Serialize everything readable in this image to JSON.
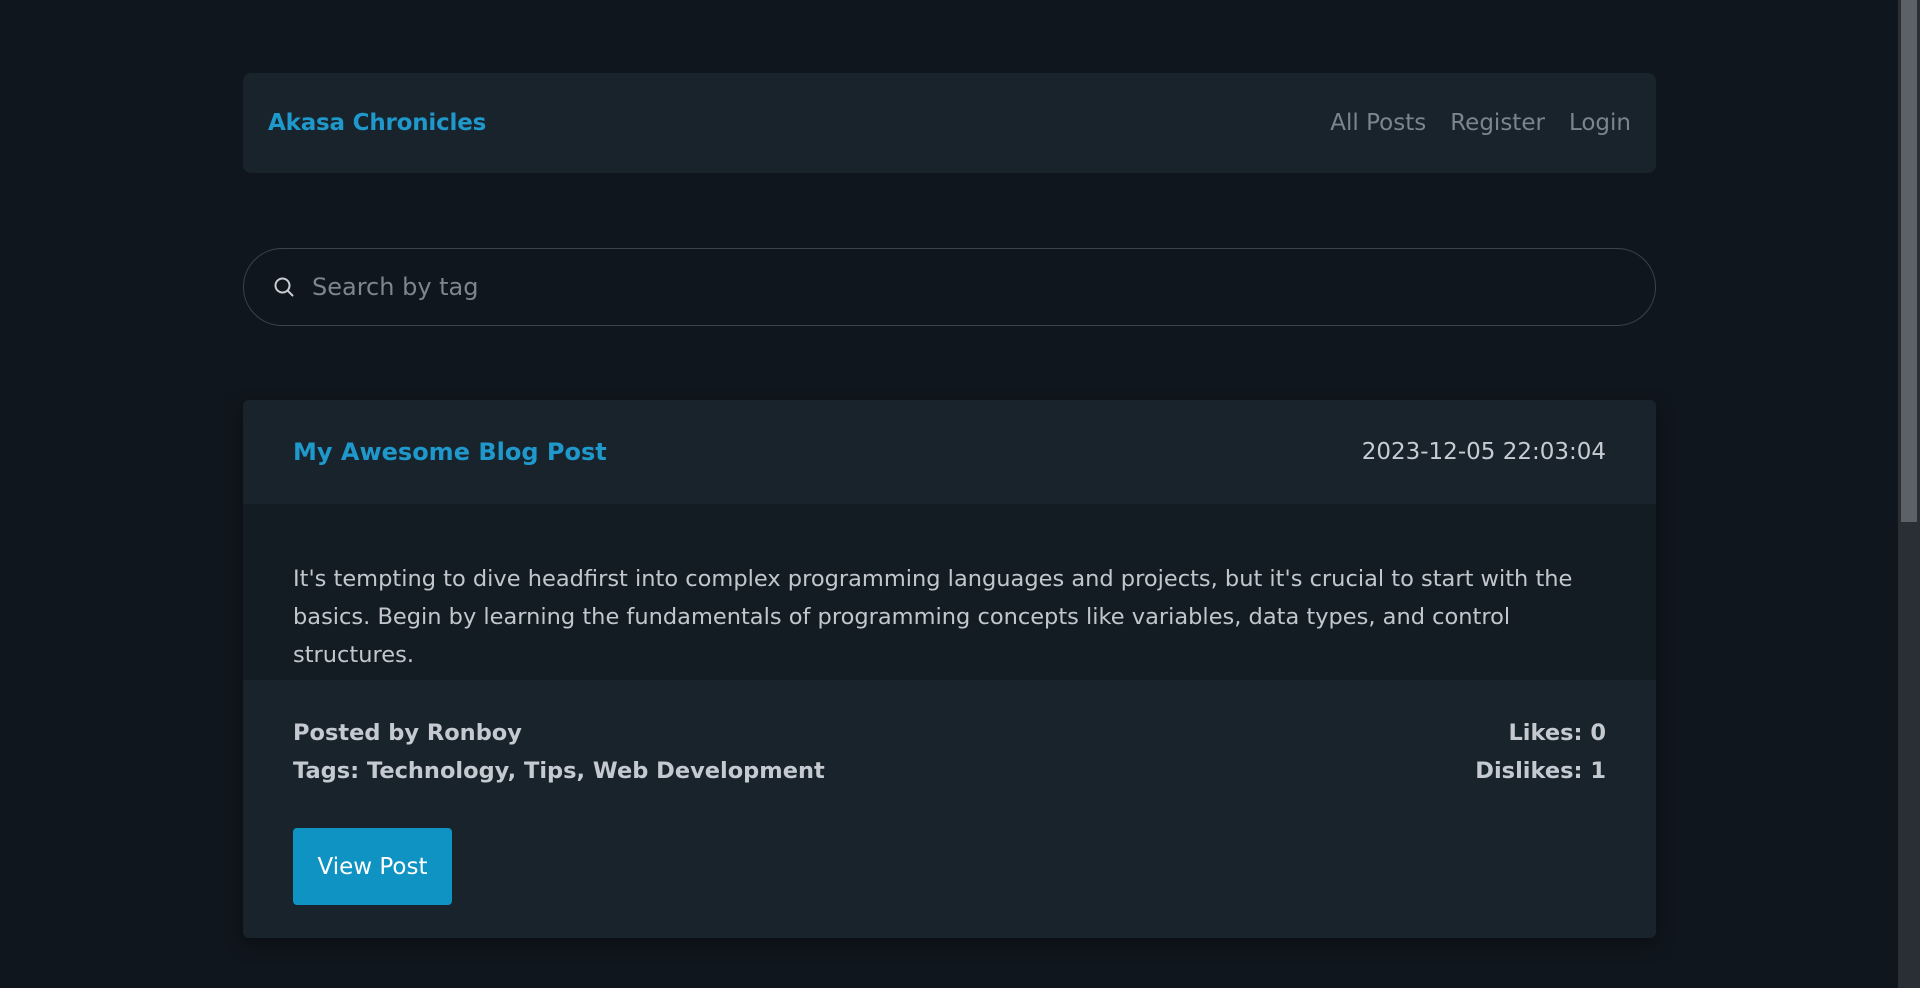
{
  "navbar": {
    "brand": "Akasa Chronicles",
    "links": [
      "All Posts",
      "Register",
      "Login"
    ]
  },
  "search": {
    "placeholder": "Search by tag",
    "icon": "search-icon"
  },
  "post": {
    "title": "My Awesome Blog Post",
    "date": "2023-12-05 22:03:04",
    "excerpt": "It's tempting to dive headfirst into complex programming languages and projects, but it's crucial to start with the basics. Begin by learning the fundamentals of programming concepts like variables, data types, and control structures.",
    "posted_by": "Posted by Ronboy",
    "tags": "Tags: Technology, Tips, Web Development",
    "likes": "Likes: 0",
    "dislikes": "Dislikes: 1",
    "view_label": "View Post"
  },
  "colors": {
    "background": "#10161d",
    "panel": "#19232c",
    "accent": "#1f98cb",
    "button": "#0f93c3"
  }
}
